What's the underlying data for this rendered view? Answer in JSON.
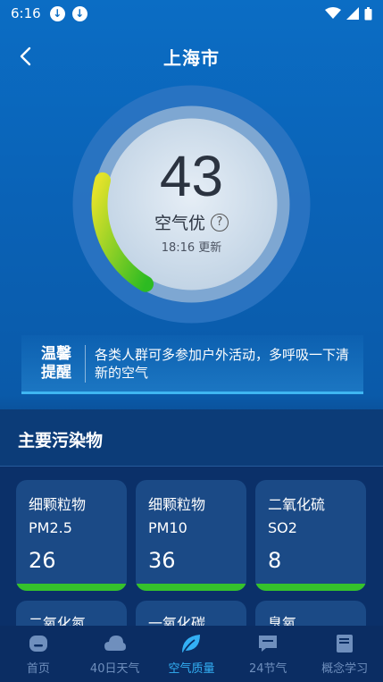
{
  "status_bar": {
    "time": "6:16"
  },
  "header": {
    "title": "上海市"
  },
  "aqi": {
    "value": "43",
    "level": "空气优",
    "updated": "18:16 更新",
    "fraction": 0.086
  },
  "tip": {
    "label_line1": "温馨",
    "label_line2": "提醒",
    "text": "各类人群可多参加户外活动，多呼吸一下清新的空气"
  },
  "pollutants": {
    "title": "主要污染物",
    "items": [
      {
        "name": "细颗粒物",
        "code": "PM2.5",
        "value": "26"
      },
      {
        "name": "细颗粒物",
        "code": "PM10",
        "value": "36"
      },
      {
        "name": "二氧化硫",
        "code": "SO2",
        "value": "8"
      }
    ],
    "partial": [
      "二氧化氮",
      "一氧化碳",
      "臭氧"
    ]
  },
  "nav": {
    "items": [
      {
        "label": "首页"
      },
      {
        "label": "40日天气"
      },
      {
        "label": "空气质量"
      },
      {
        "label": "24节气"
      },
      {
        "label": "概念学习"
      }
    ]
  },
  "colors": {
    "accent": "#33b0f5",
    "good": "#35c22c"
  }
}
